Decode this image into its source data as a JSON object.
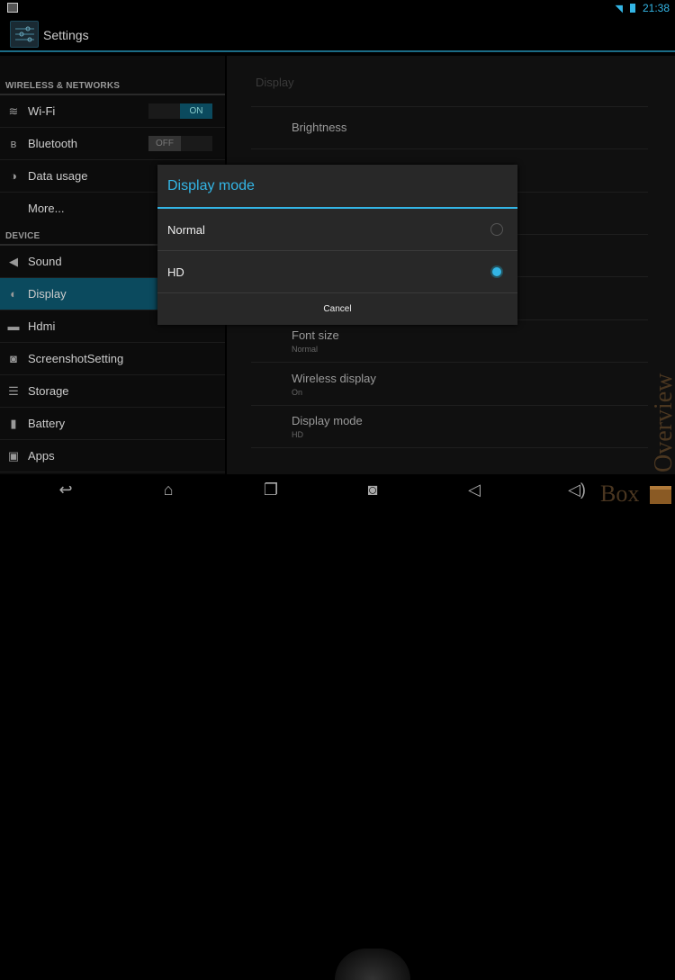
{
  "status": {
    "time": "21:38"
  },
  "app": {
    "title": "Settings"
  },
  "sidebar": {
    "sections": [
      {
        "title": "WIRELESS & NETWORKS"
      },
      {
        "title": "DEVICE"
      }
    ],
    "items": [
      {
        "label": "Wi-Fi",
        "icon": "wifi-icon",
        "toggle": "ON"
      },
      {
        "label": "Bluetooth",
        "icon": "bluetooth-icon",
        "toggle": "OFF"
      },
      {
        "label": "Data usage",
        "icon": "data-usage-icon"
      },
      {
        "label": "More..."
      },
      {
        "label": "Sound",
        "icon": "sound-icon"
      },
      {
        "label": "Display",
        "icon": "display-icon",
        "selected": true
      },
      {
        "label": "Hdmi",
        "icon": "hdmi-icon"
      },
      {
        "label": "ScreenshotSetting",
        "icon": "camera-icon"
      },
      {
        "label": "Storage",
        "icon": "storage-icon"
      },
      {
        "label": "Battery",
        "icon": "battery-icon"
      },
      {
        "label": "Apps",
        "icon": "apps-icon"
      }
    ]
  },
  "detail": {
    "header": "Display",
    "items": [
      {
        "title": "Brightness"
      },
      {
        "title": "Font size",
        "summary": "Normal"
      },
      {
        "title": "Wireless display",
        "summary": "On"
      },
      {
        "title": "Display mode",
        "summary": "HD"
      }
    ]
  },
  "dialog": {
    "title": "Display mode",
    "options": [
      {
        "label": "Normal",
        "selected": false
      },
      {
        "label": "HD",
        "selected": true
      }
    ],
    "cancel": "Cancel"
  },
  "watermark": {
    "text1": "Box",
    "text2": "Overview"
  },
  "colors": {
    "accent": "#33b5e5",
    "selected": "#0b4a5e"
  }
}
